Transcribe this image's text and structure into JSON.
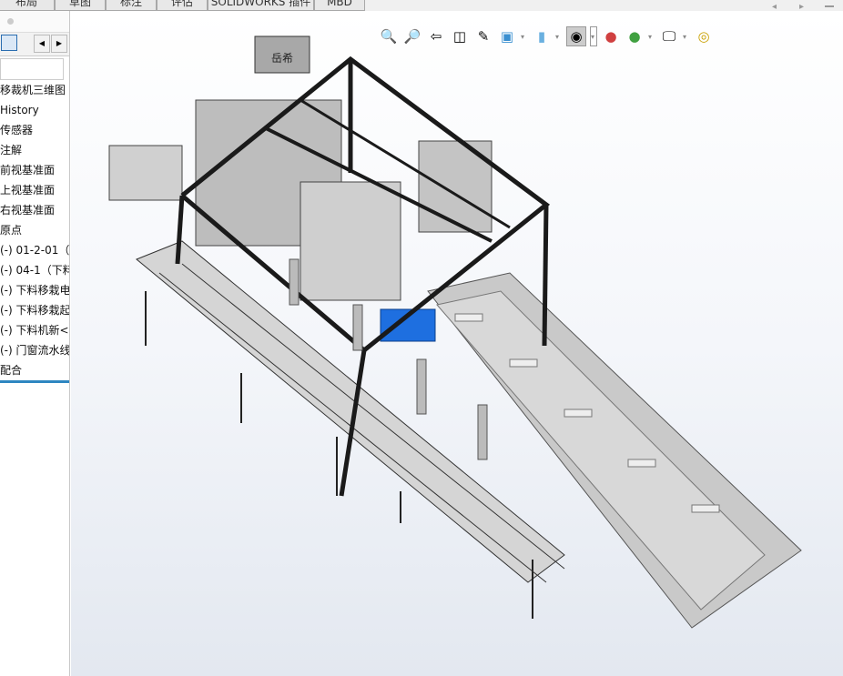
{
  "tabs": [
    "布局",
    "草图",
    "标注",
    "评估",
    "SOLIDWORKS 插件",
    "MBD"
  ],
  "tree": {
    "items": [
      "移裁机三维图",
      "History",
      "传感器",
      "注解",
      "前视基准面",
      "上视基准面",
      "右视基准面",
      "原点",
      "(-) 01-2-01（",
      "(-) 04-1（下料",
      "(-) 下料移栽电",
      "(-) 下料移栽起",
      "(-) 下料机新<",
      "(-) 门窗流水线",
      "配合"
    ]
  },
  "toolbar": {
    "icons": [
      "zoom-to-fit-icon",
      "zoom-to-area-icon",
      "previous-view-icon",
      "section-view-icon",
      "dynamic-annotation-icon",
      "view-orientation-icon",
      "display-style-icon",
      "hide-show-items-icon",
      "edit-appearance-icon",
      "apply-scene-icon",
      "view-settings-icon",
      "measure-icon"
    ]
  },
  "model": {
    "label": "岳希"
  },
  "colors": {
    "frame": "#1a1a1a",
    "sheet": "#c8c8c8",
    "motor": "#1e6fe0",
    "accent": "#2e86c1"
  }
}
